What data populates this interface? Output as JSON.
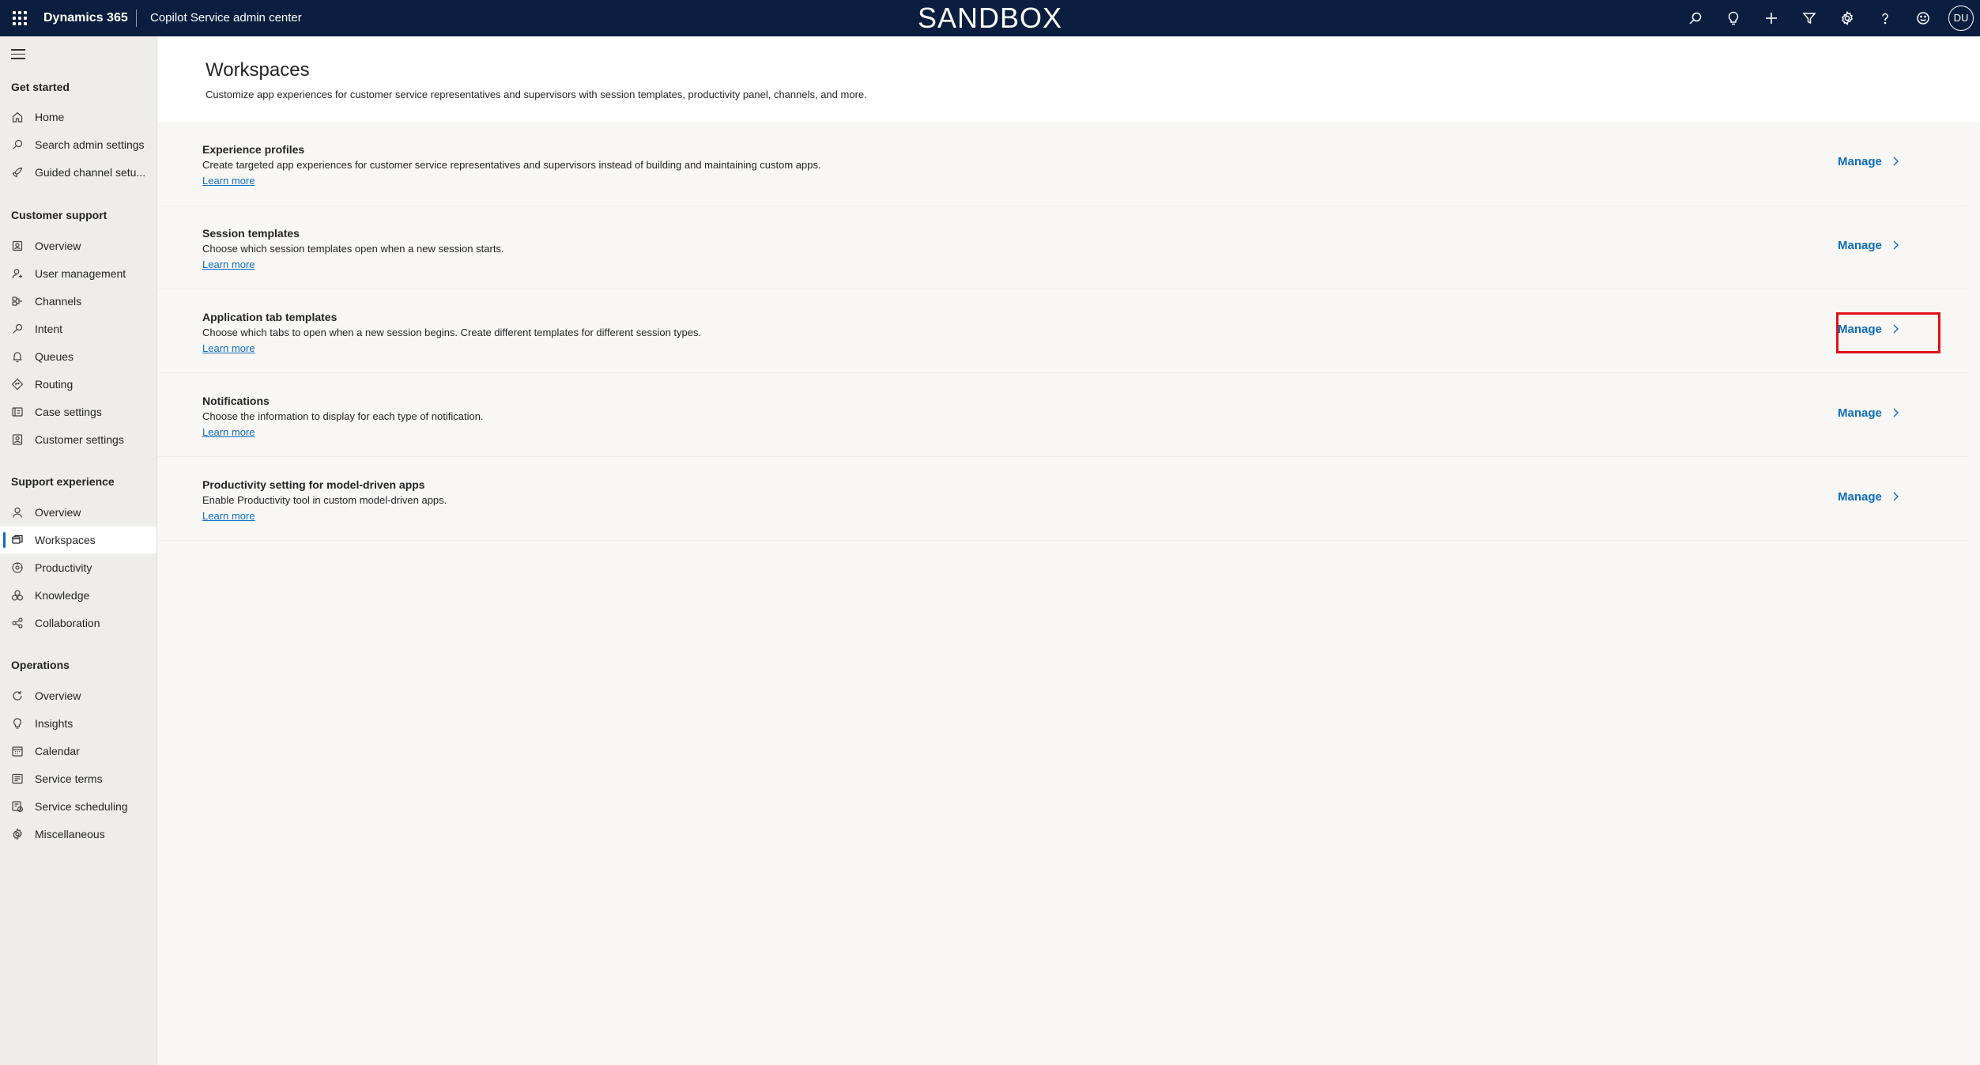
{
  "topbar": {
    "brand": "Dynamics 365",
    "app_name": "Copilot Service admin center",
    "environment": "SANDBOX",
    "icons": [
      "search-icon",
      "lightbulb-icon",
      "add-icon",
      "filter-icon",
      "settings-icon",
      "help-icon",
      "feedback-smile-icon"
    ],
    "avatar_initials": "DU"
  },
  "sidebar": {
    "groups": [
      {
        "title": "Get started",
        "items": [
          {
            "label": "Home",
            "icon": "home-icon"
          },
          {
            "label": "Search admin settings",
            "icon": "search-icon"
          },
          {
            "label": "Guided channel setu...",
            "icon": "rocket-icon"
          }
        ]
      },
      {
        "title": "Customer support",
        "items": [
          {
            "label": "Overview",
            "icon": "overview-icon"
          },
          {
            "label": "User management",
            "icon": "people-icon"
          },
          {
            "label": "Channels",
            "icon": "channels-icon"
          },
          {
            "label": "Intent",
            "icon": "intent-icon"
          },
          {
            "label": "Queues",
            "icon": "queues-icon"
          },
          {
            "label": "Routing",
            "icon": "routing-icon"
          },
          {
            "label": "Case settings",
            "icon": "case-icon"
          },
          {
            "label": "Customer settings",
            "icon": "customer-icon"
          }
        ]
      },
      {
        "title": "Support experience",
        "items": [
          {
            "label": "Overview",
            "icon": "person-icon"
          },
          {
            "label": "Workspaces",
            "icon": "workspaces-icon",
            "selected": true
          },
          {
            "label": "Productivity",
            "icon": "productivity-icon"
          },
          {
            "label": "Knowledge",
            "icon": "knowledge-icon"
          },
          {
            "label": "Collaboration",
            "icon": "collaboration-icon"
          }
        ]
      },
      {
        "title": "Operations",
        "items": [
          {
            "label": "Overview",
            "icon": "refresh-icon"
          },
          {
            "label": "Insights",
            "icon": "lightbulb-icon"
          },
          {
            "label": "Calendar",
            "icon": "calendar-icon"
          },
          {
            "label": "Service terms",
            "icon": "terms-icon"
          },
          {
            "label": "Service scheduling",
            "icon": "scheduling-icon"
          },
          {
            "label": "Miscellaneous",
            "icon": "gear-icon"
          }
        ]
      }
    ]
  },
  "main": {
    "title": "Workspaces",
    "subtitle": "Customize app experiences for customer service representatives and supervisors with session templates, productivity panel, channels, and more.",
    "rows": [
      {
        "title": "Experience profiles",
        "description": "Create targeted app experiences for customer service representatives and supervisors instead of building and maintaining custom apps.",
        "link": "Learn more",
        "action": "Manage"
      },
      {
        "title": "Session templates",
        "description": "Choose which session templates open when a new session starts.",
        "link": "Learn more",
        "action": "Manage"
      },
      {
        "title": "Application tab templates",
        "description": "Choose which tabs to open when a new session begins. Create different templates for different session types.",
        "link": "Learn more",
        "action": "Manage",
        "highlighted": true
      },
      {
        "title": "Notifications",
        "description": "Choose the information to display for each type of notification.",
        "link": "Learn more",
        "action": "Manage"
      },
      {
        "title": "Productivity setting for model-driven apps",
        "description": "Enable Productivity tool in custom model-driven apps.",
        "link": "Learn more",
        "action": "Manage"
      }
    ]
  },
  "colors": {
    "topbar": "#0b1e3f",
    "accent": "#0f6cbd",
    "highlight": "#e3101a"
  }
}
